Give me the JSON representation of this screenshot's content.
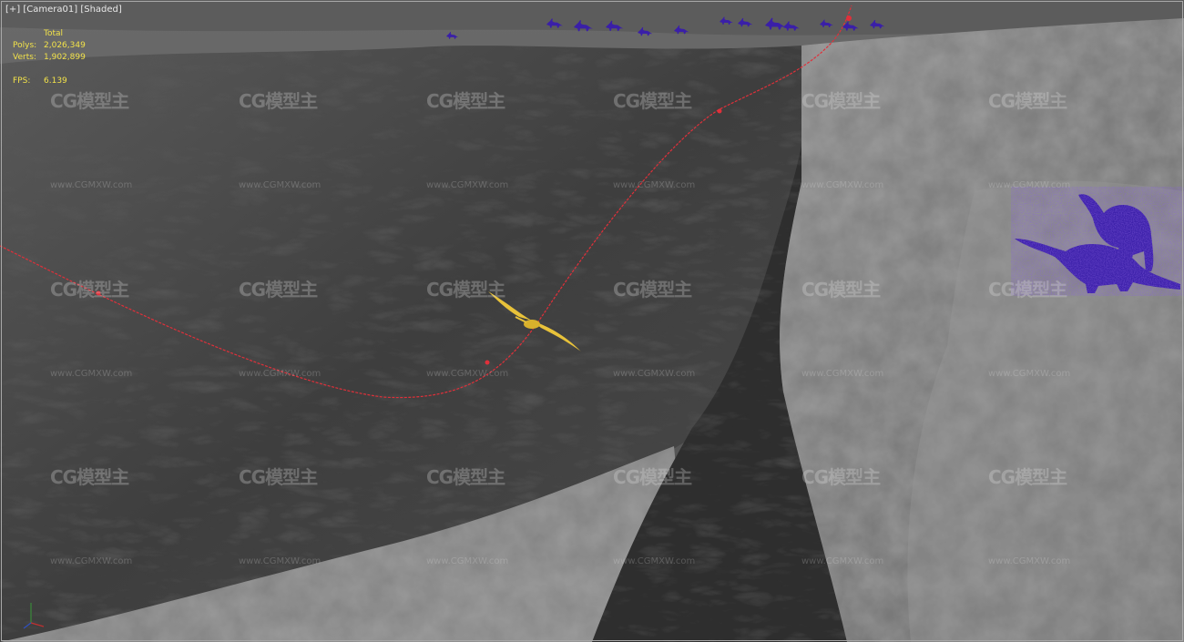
{
  "viewport": {
    "plus_label": "[+]",
    "camera_label": "[Camera01]",
    "shading_label": "[Shaded]"
  },
  "stats": {
    "header": "Total",
    "polys_label": "Polys:",
    "polys_value": "2,026,349",
    "verts_label": "Verts:",
    "verts_value": "1,902,899",
    "fps_label": "FPS:",
    "fps_value": "6.139"
  },
  "watermark": {
    "logo_text": "CG模型主",
    "url_text": "www.CGMXW.com"
  },
  "colors": {
    "stats_text": "#f2e24a",
    "path_curve": "#e0303a",
    "dinosaurs": "#3a1fa8",
    "pterosaur": "#e8c23a",
    "terrain_dark": "#2c2c2c",
    "terrain_light": "#8a8a8a"
  },
  "objects": {
    "pterosaur": "pterosaur-model",
    "dinosaur_herd": "brachiosaurus-herd",
    "path": "camera-path-spline",
    "gizmo": "axis-gizmo-icon"
  }
}
